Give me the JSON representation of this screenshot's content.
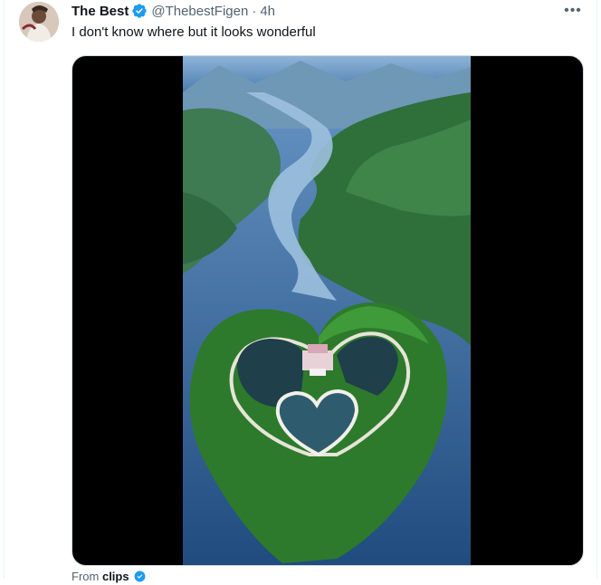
{
  "tweet": {
    "author_name": "The Best",
    "handle": "@ThebestFigen",
    "separator": "·",
    "time": "4h",
    "text": "I don't know where but it looks wonderful",
    "more_label": "•••",
    "source_prefix": "From",
    "source_name": "clips"
  },
  "colors": {
    "verified": "#1d9bf0",
    "secondary_text": "#536471",
    "primary_text": "#0f1419"
  },
  "icons": {
    "verified": "verified-badge-icon",
    "more": "more-options-icon"
  }
}
